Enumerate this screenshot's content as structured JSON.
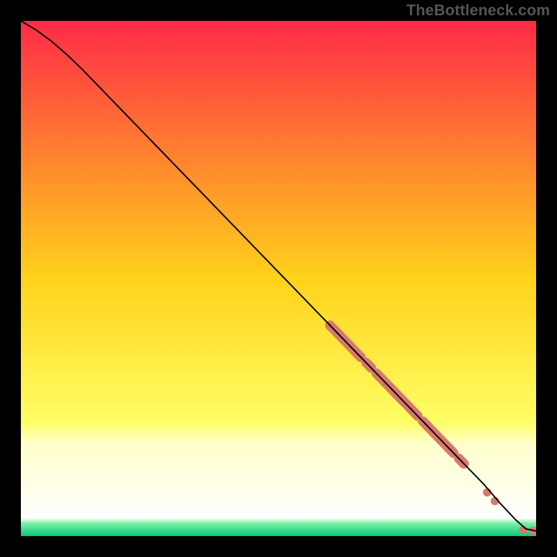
{
  "watermark": "TheBottleneck.com",
  "chart_data": {
    "type": "line",
    "title": "",
    "xlabel": "",
    "ylabel": "",
    "xlim": [
      0,
      100
    ],
    "ylim": [
      0,
      100
    ],
    "grid": false,
    "legend": false,
    "background_gradient": {
      "stops": [
        {
          "pos": 0.0,
          "color": "#ff2a47"
        },
        {
          "pos": 0.5,
          "color": "#ffd21a"
        },
        {
          "pos": 0.78,
          "color": "#ffff66"
        },
        {
          "pos": 0.82,
          "color": "#ffffcc"
        },
        {
          "pos": 0.965,
          "color": "#ffffff"
        },
        {
          "pos": 0.975,
          "color": "#7ff0a5"
        },
        {
          "pos": 1.0,
          "color": "#00cc7a"
        }
      ]
    },
    "curve": {
      "description": "Monotone decreasing bottleneck curve; near-linear after initial bend, flattening at the bottom-right.",
      "x": [
        0,
        3,
        6,
        9,
        12,
        15,
        18,
        21,
        24,
        27,
        30,
        33,
        36,
        39,
        42,
        45,
        48,
        51,
        54,
        57,
        60,
        63,
        66,
        69,
        72,
        75,
        78,
        81,
        84,
        87,
        90,
        93,
        96,
        98,
        100
      ],
      "y": [
        100,
        98.2,
        96.0,
        93.4,
        90.5,
        87.4,
        84.3,
        81.2,
        78.1,
        75.0,
        71.9,
        68.8,
        65.7,
        62.6,
        59.5,
        56.4,
        53.3,
        50.2,
        47.1,
        44.0,
        40.9,
        37.8,
        34.7,
        31.6,
        28.5,
        25.4,
        22.3,
        19.2,
        16.1,
        13.0,
        9.9,
        6.4,
        3.2,
        1.4,
        1.0
      ]
    },
    "marker_clusters": [
      {
        "x_start": 60,
        "x_end": 66,
        "size": 7
      },
      {
        "x_start": 67,
        "x_end": 68,
        "size": 7
      },
      {
        "x_start": 69,
        "x_end": 74,
        "size": 7
      },
      {
        "x_start": 74,
        "x_end": 77,
        "size": 7
      },
      {
        "x_start": 78,
        "x_end": 79,
        "size": 7
      },
      {
        "x_start": 79,
        "x_end": 84,
        "size": 7
      },
      {
        "x_start": 85,
        "x_end": 86,
        "size": 7
      }
    ],
    "marker_points": [
      {
        "x": 90.5,
        "y": 8.5,
        "size": 6
      },
      {
        "x": 92.0,
        "y": 6.8,
        "size": 6
      },
      {
        "x": 97.5,
        "y": 1.2,
        "size": 6
      },
      {
        "x": 99.5,
        "y": 1.0,
        "size": 6
      }
    ],
    "marker_color": "#d9786a",
    "line_color": "#000000",
    "line_width": 2.0
  }
}
